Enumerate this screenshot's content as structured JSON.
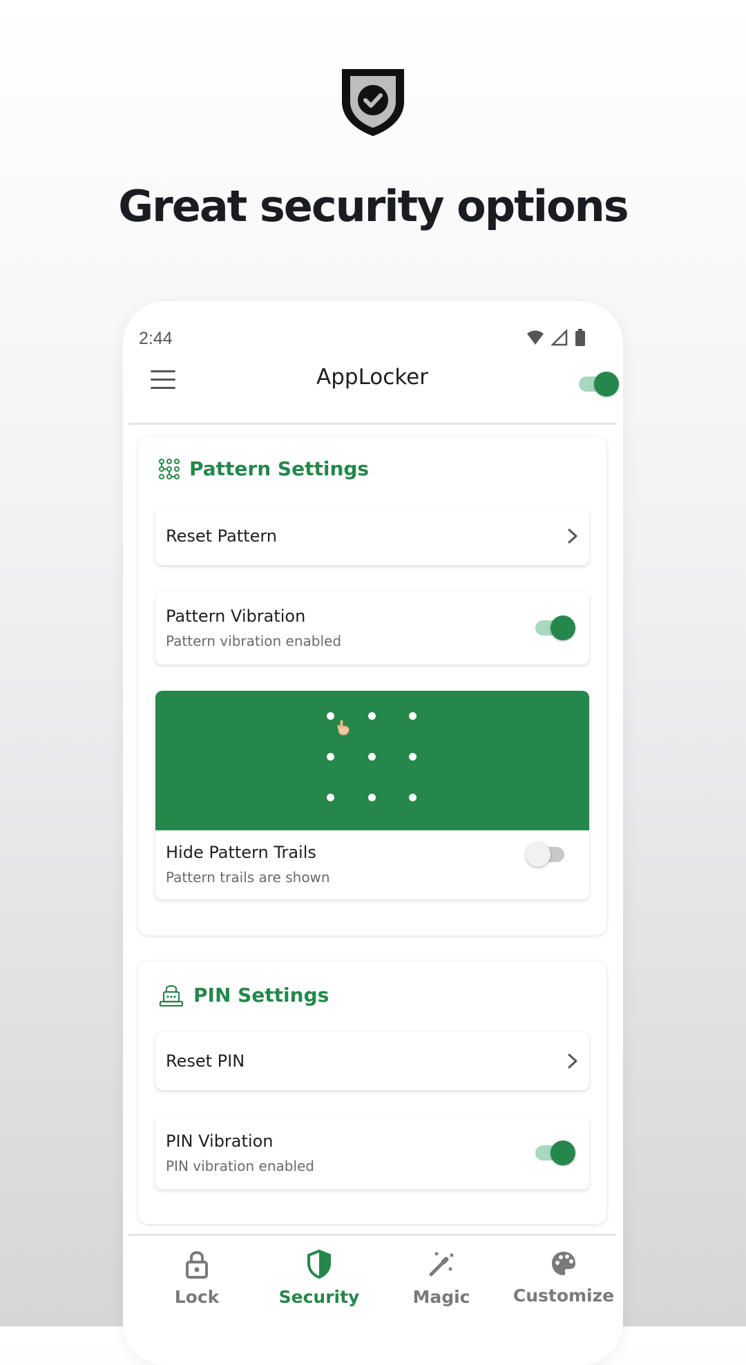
{
  "hero": {
    "headline": "Great security options"
  },
  "status_bar": {
    "time": "2:44"
  },
  "app_bar": {
    "title": "AppLocker",
    "master_toggle_on": true
  },
  "pattern_settings": {
    "title": "Pattern Settings",
    "reset": {
      "label": "Reset Pattern"
    },
    "vibration": {
      "title": "Pattern Vibration",
      "subtitle": "Pattern vibration enabled",
      "enabled": true
    },
    "trails": {
      "title": "Hide Pattern Trails",
      "subtitle": "Pattern trails are shown",
      "enabled": false
    }
  },
  "pin_settings": {
    "title": "PIN Settings",
    "reset": {
      "label": "Reset PIN"
    },
    "vibration": {
      "title": "PIN Vibration",
      "subtitle": "PIN vibration enabled",
      "enabled": true
    }
  },
  "bottom_nav": {
    "items": [
      {
        "label": "Lock",
        "icon": "padlock-icon",
        "active": false
      },
      {
        "label": "Security",
        "icon": "shield-icon",
        "active": true
      },
      {
        "label": "Magic",
        "icon": "magic-wand-icon",
        "active": false
      },
      {
        "label": "Customize",
        "icon": "palette-icon",
        "active": false
      }
    ]
  },
  "colors": {
    "accent": "#25874c",
    "text": "#1f1f1f",
    "muted": "#6a6a6a"
  }
}
